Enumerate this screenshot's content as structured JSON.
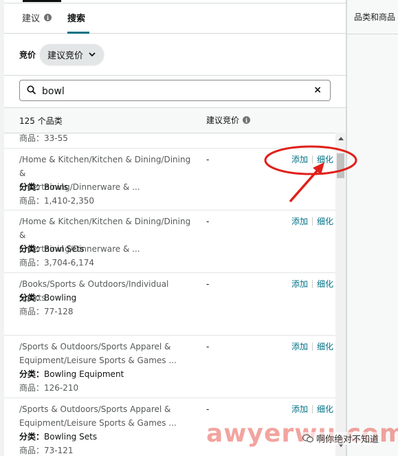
{
  "tabs": [
    {
      "label": "建议",
      "active": false
    },
    {
      "label": "搜索",
      "active": true
    }
  ],
  "bid": {
    "label": "竞价",
    "dropdown_value": "建议竞价"
  },
  "search": {
    "value": "bowl",
    "clear_label": "×"
  },
  "columns": {
    "count_label": "125 个品类",
    "bid_label": "建议竞价"
  },
  "right_panel": {
    "title": "品类和商品"
  },
  "partial_row": {
    "products": "商品：33-55"
  },
  "rows": [
    {
      "path_line1": "/Home & Kitchen/Kitchen & Dining/Dining &",
      "path_line2": "Entertaining/Dinnerware & ...",
      "category_prefix": "分类：",
      "category": "Bowls",
      "products": "商品：1,410-2,350",
      "bid": "-",
      "add": "添加",
      "refine": "细化"
    },
    {
      "path_line1": "/Home & Kitchen/Kitchen & Dining/Dining &",
      "path_line2": "Entertaining/Dinnerware & ...",
      "category_prefix": "分类：",
      "category": "Bowl Sets",
      "products": "商品：3,704-6,174",
      "bid": "-",
      "add": "添加",
      "refine": "细化"
    },
    {
      "path_line1": "/Books/Sports & Outdoors/Individual Sports",
      "path_line2": "",
      "category_prefix": "分类：",
      "category": "Bowling",
      "products": "商品：77-128",
      "bid": "-",
      "add": "添加",
      "refine": "细化"
    },
    {
      "path_line1": "/Sports & Outdoors/Sports Apparel &",
      "path_line2": "Equipment/Leisure Sports & Games ...",
      "category_prefix": "分类：",
      "category": "Bowling Equipment",
      "products": "商品：126-210",
      "bid": "-",
      "add": "添加",
      "refine": "细化"
    },
    {
      "path_line1": "/Sports & Outdoors/Sports Apparel &",
      "path_line2": "Equipment/Leisure Sports & Games ...",
      "category_prefix": "分类：",
      "category": "Bowling Sets",
      "products": "商品：73-121",
      "bid": "-",
      "add": "添加",
      "refine": "细化"
    }
  ],
  "watermark": {
    "text": "awyerwu.com",
    "wechat": "啊你绝对不知道"
  },
  "colors": {
    "link": "#007185",
    "annotation_red": "#e0201a",
    "tab_accent": "#007185"
  }
}
